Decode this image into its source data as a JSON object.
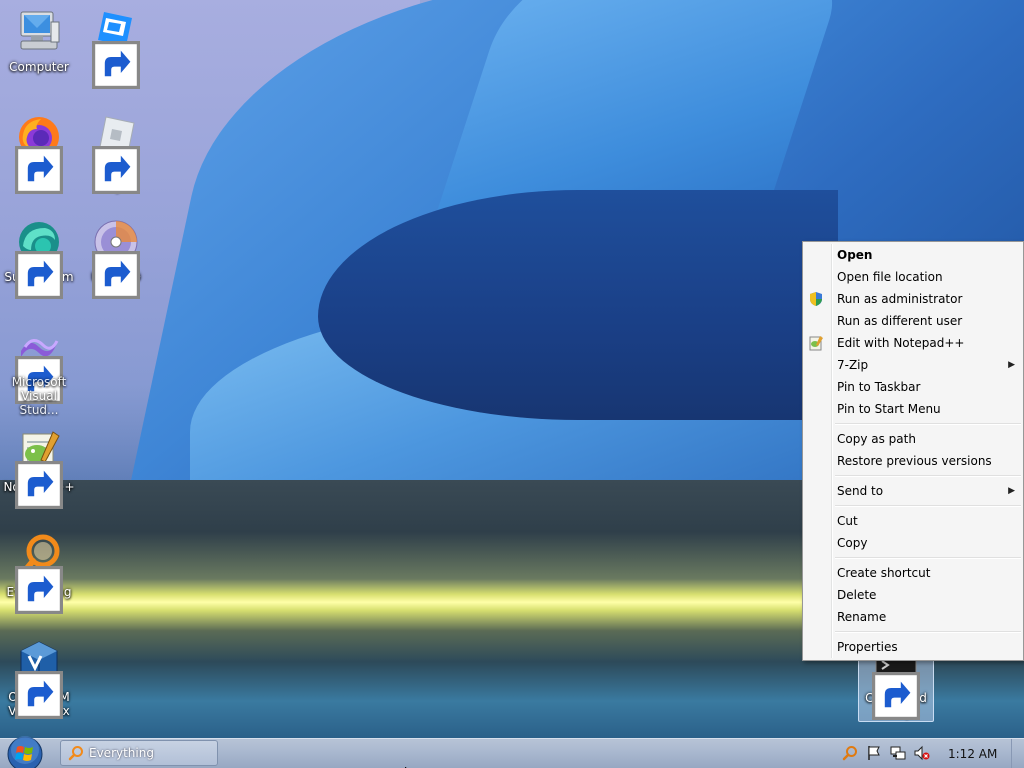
{
  "desktop": {
    "icons": [
      {
        "label": "Computer",
        "icon": "computer-icon",
        "shortcut": false
      },
      {
        "label": "Roblox Studio",
        "icon": "roblox-studio-icon",
        "shortcut": true
      },
      {
        "label": "Firefox",
        "icon": "firefox-icon",
        "shortcut": true
      },
      {
        "label": "Roblox Player",
        "icon": "roblox-player-icon",
        "shortcut": true
      },
      {
        "label": "Supermium",
        "icon": "supermium-icon",
        "shortcut": true
      },
      {
        "label": "UltraISO",
        "icon": "ultraiso-icon",
        "shortcut": true
      },
      {
        "label": "Microsoft Visual Stud...",
        "icon": "visual-studio-icon",
        "shortcut": true
      },
      {
        "label": "Notepad++",
        "icon": "notepad-plus-plus-icon",
        "shortcut": true
      },
      {
        "label": "Everything",
        "icon": "everything-search-icon",
        "shortcut": true
      },
      {
        "label": "Oracle VM VirtualBox",
        "icon": "virtualbox-icon",
        "shortcut": true
      },
      {
        "label": "Command Prompt",
        "icon": "command-prompt-icon",
        "shortcut": true,
        "selected": true
      }
    ]
  },
  "context_menu": {
    "items": {
      "open": "Open",
      "open_file_location": "Open file location",
      "run_as_admin": "Run as administrator",
      "run_as_different_user": "Run as different user",
      "edit_with_notepad": "Edit with Notepad++",
      "seven_zip": "7-Zip",
      "pin_taskbar": "Pin to Taskbar",
      "pin_start": "Pin to Start Menu",
      "copy_as_path": "Copy as path",
      "restore_previous": "Restore previous versions",
      "send_to": "Send to",
      "cut": "Cut",
      "copy": "Copy",
      "create_shortcut": "Create shortcut",
      "delete": "Delete",
      "rename": "Rename",
      "properties": "Properties"
    },
    "submenu_arrow": "▶"
  },
  "taskbar": {
    "running_app": "Everything",
    "clock": "1:12 AM",
    "tray_icons": [
      "everything-tray-icon",
      "action-center-flag-icon",
      "network-icon",
      "volume-muted-icon"
    ]
  }
}
